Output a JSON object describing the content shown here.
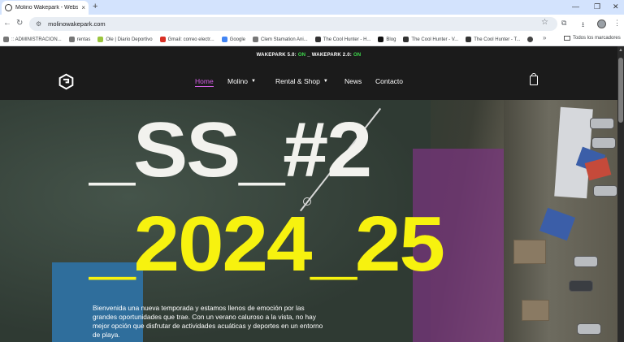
{
  "browser": {
    "tab": {
      "title": "Molino Wakepark - Website",
      "close": "×"
    },
    "new_tab": "+",
    "window": {
      "minimize": "—",
      "restore": "❐",
      "close": "✕"
    },
    "nav": {
      "back": "←",
      "forward": "→",
      "reload": "↻"
    },
    "address": {
      "url": "molinowakepark.com",
      "tune_icon": "⚙"
    },
    "toolbar": {
      "star": "☆",
      "extensions": "⧉",
      "download": "⭳",
      "menu": "⋮"
    },
    "bookmarks": [
      {
        "label": ":: ADMINISTRACION..."
      },
      {
        "label": "rentas"
      },
      {
        "label": "Ole | Diario Deportivo"
      },
      {
        "label": "Gmail: correo electr..."
      },
      {
        "label": "Google"
      },
      {
        "label": "Clem Stamation Ani..."
      },
      {
        "label": "The Cool Hunter - H..."
      },
      {
        "label": "Blog"
      },
      {
        "label": "The Cool Hunter - V..."
      },
      {
        "label": "The Cool Hunter - T..."
      },
      {
        "label": ""
      }
    ],
    "bookmarks_more": "»",
    "all_bookmarks": "Todos los marcadores"
  },
  "site": {
    "topbar": {
      "w5": "WAKEPARK 5.0:",
      "w5_status": "ON",
      "sep": "_",
      "w2": "WAKEPARK 2.0:",
      "w2_status": "ON"
    },
    "menu": {
      "home": "Home",
      "molino": "Molino",
      "rental": "Rental & Shop",
      "news": "News",
      "contacto": "Contacto"
    },
    "hero": {
      "line1": "_SS_#2",
      "line2": "_2024_25",
      "description": "Bienvenida una nueva temporada y estamos llenos de emoción por las grandes oportunidades que trae. Con un verano caluroso a la vista, no hay mejor opción que disfrutar de actividades acuáticas y deportes en un entorno de playa."
    },
    "colors": {
      "accent": "#d45ee7",
      "yellow": "#f7f20f",
      "on_green": "#3ddc4c"
    }
  }
}
